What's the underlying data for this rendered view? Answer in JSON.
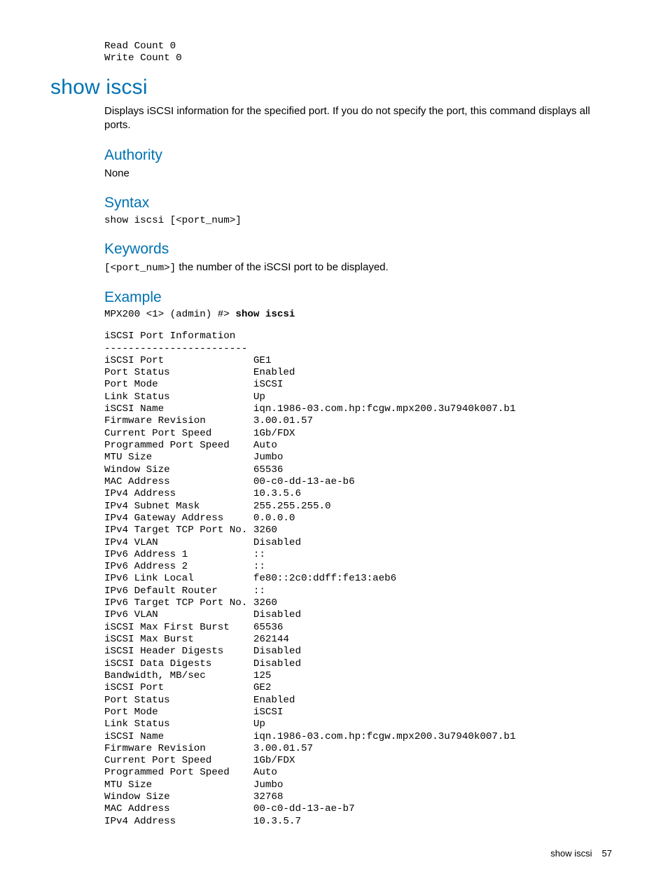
{
  "top_pre": "Read Count 0\nWrite Count 0",
  "h1": "show iscsi",
  "intro": "Displays iSCSI information for the specified port. If you do not specify the port, this command displays all ports.",
  "authority": {
    "heading": "Authority",
    "body": "None"
  },
  "syntax": {
    "heading": "Syntax",
    "code": "show iscsi [<port_num>]"
  },
  "keywords": {
    "heading": "Keywords",
    "code": "[<port_num>]",
    "rest": " the number of the iSCSI port to be displayed."
  },
  "example": {
    "heading": "Example",
    "prompt_prefix": "MPX200 <1> (admin) #> ",
    "prompt_cmd": "show iscsi",
    "body": "iSCSI Port Information\n------------------------\niSCSI Port               GE1\nPort Status              Enabled\nPort Mode                iSCSI\nLink Status              Up\niSCSI Name               iqn.1986-03.com.hp:fcgw.mpx200.3u7940k007.b1\nFirmware Revision        3.00.01.57\nCurrent Port Speed       1Gb/FDX\nProgrammed Port Speed    Auto\nMTU Size                 Jumbo\nWindow Size              65536\nMAC Address              00-c0-dd-13-ae-b6\nIPv4 Address             10.3.5.6\nIPv4 Subnet Mask         255.255.255.0\nIPv4 Gateway Address     0.0.0.0\nIPv4 Target TCP Port No. 3260\nIPv4 VLAN                Disabled\nIPv6 Address 1           ::\nIPv6 Address 2           ::\nIPv6 Link Local          fe80::2c0:ddff:fe13:aeb6\nIPv6 Default Router      ::\nIPv6 Target TCP Port No. 3260\nIPv6 VLAN                Disabled\niSCSI Max First Burst    65536\niSCSI Max Burst          262144\niSCSI Header Digests     Disabled\niSCSI Data Digests       Disabled\nBandwidth, MB/sec        125\niSCSI Port               GE2\nPort Status              Enabled\nPort Mode                iSCSI\nLink Status              Up\niSCSI Name               iqn.1986-03.com.hp:fcgw.mpx200.3u7940k007.b1\nFirmware Revision        3.00.01.57\nCurrent Port Speed       1Gb/FDX\nProgrammed Port Speed    Auto\nMTU Size                 Jumbo\nWindow Size              32768\nMAC Address              00-c0-dd-13-ae-b7\nIPv4 Address             10.3.5.7"
  },
  "footer": {
    "label": "show iscsi",
    "page": "57"
  }
}
